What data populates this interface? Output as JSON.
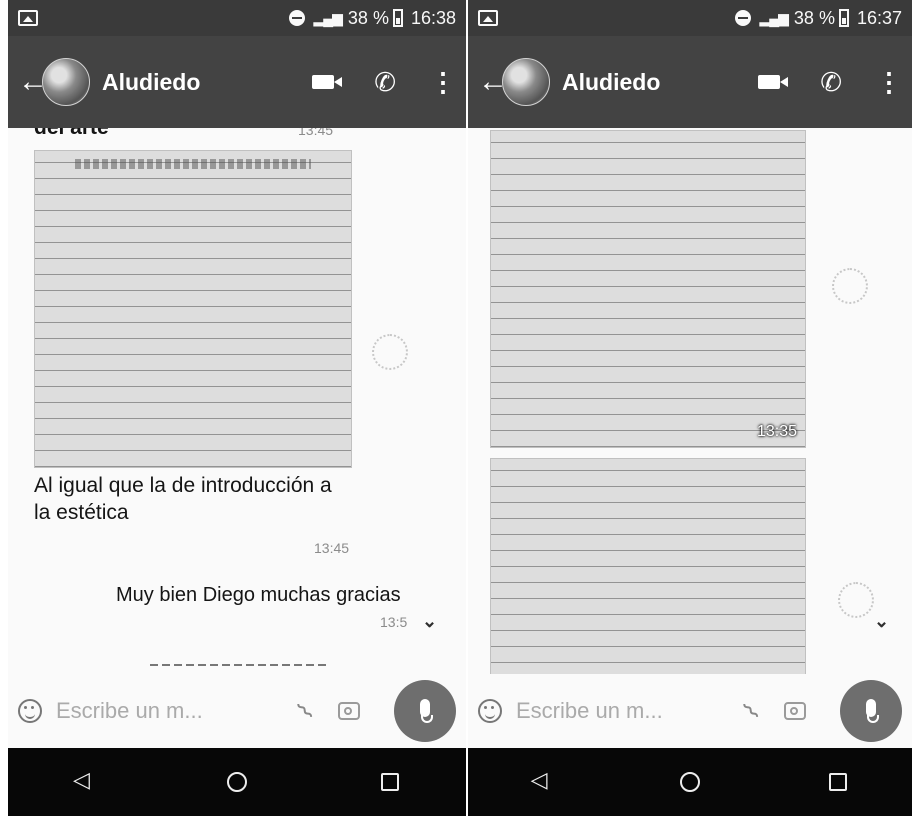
{
  "left": {
    "status": {
      "battery": "38 %",
      "time": "16:38"
    },
    "header": {
      "contact_name": "Aludiedo"
    },
    "messages": {
      "cutoff_text": "del arte",
      "cutoff_time": "13:45",
      "caption": "Al igual que la de introducción a la estética",
      "caption_time": "13:45",
      "outgoing_text": "Muy bien Diego muchas gracias",
      "outgoing_time": "13:5"
    },
    "input": {
      "placeholder": "Escribe un m..."
    }
  },
  "right": {
    "status": {
      "battery": "38 %",
      "time": "16:37"
    },
    "header": {
      "contact_name": "Aludiedo"
    },
    "messages": {
      "image1_time": "13:35"
    },
    "input": {
      "placeholder": "Escribe un m..."
    }
  },
  "icons": {
    "scroll_down": "double-chevron-down-icon",
    "mic": "mic-icon",
    "camera": "camera-icon",
    "attach": "paperclip-icon",
    "emoji": "emoji-icon"
  }
}
